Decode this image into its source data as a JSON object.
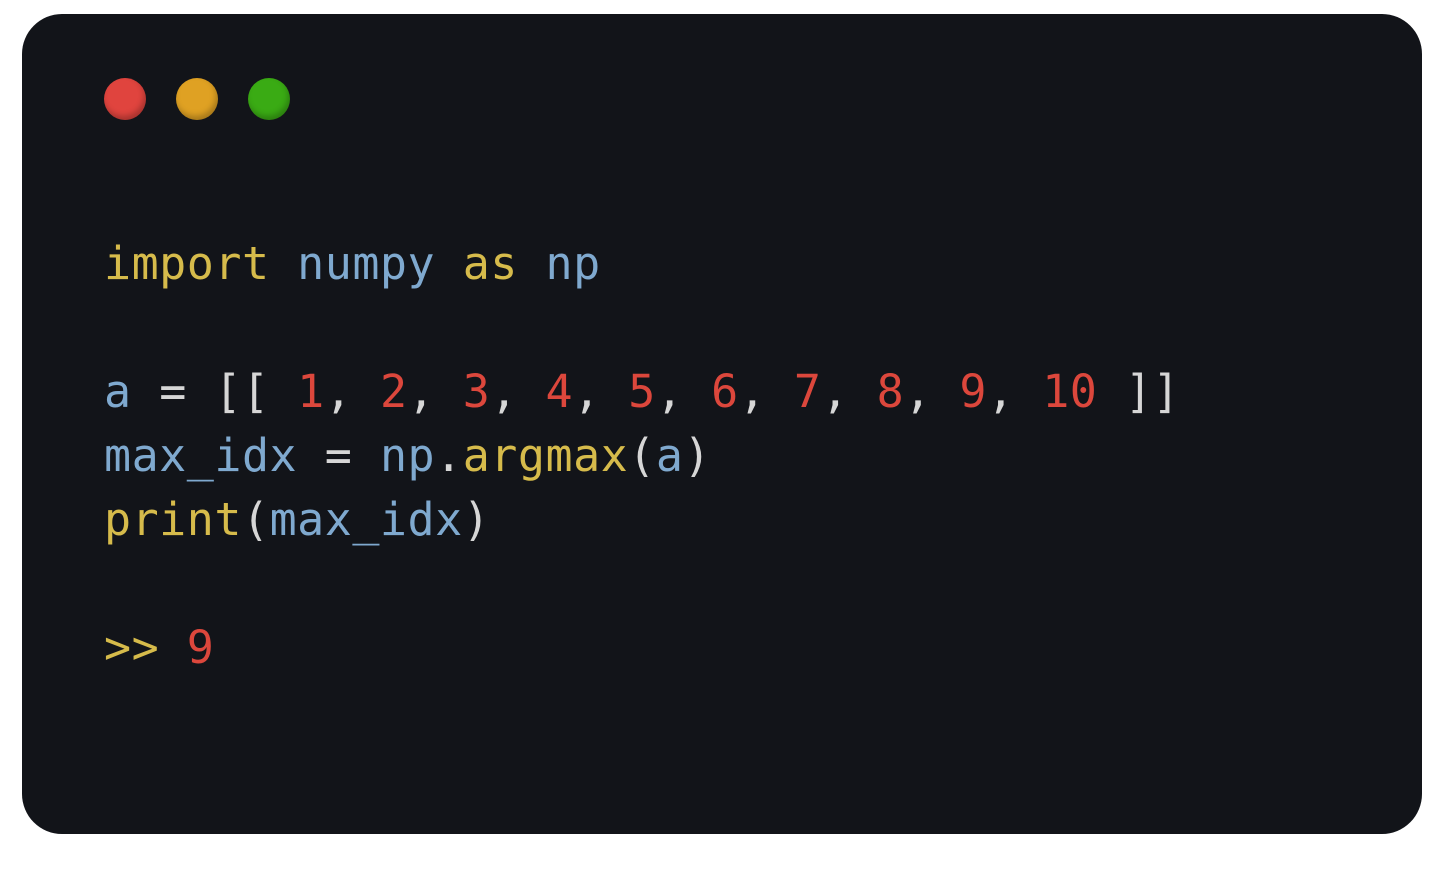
{
  "traffic_lights": {
    "red": "#e0443e",
    "yellow": "#dfa123",
    "green": "#3aab14"
  },
  "code": {
    "line1": {
      "import_kw": "import",
      "module": "numpy",
      "as_kw": "as",
      "alias": "np"
    },
    "line2_blank": "",
    "line3": {
      "var": "a",
      "eq": "=",
      "open": "[[ ",
      "nums": [
        "1",
        "2",
        "3",
        "4",
        "5",
        "6",
        "7",
        "8",
        "9",
        "10"
      ],
      "close": " ]]",
      "sep": ", "
    },
    "line4": {
      "var": "max_idx",
      "eq": "=",
      "obj": "np",
      "dot": ".",
      "fn": "argmax",
      "lp": "(",
      "arg": "a",
      "rp": ")"
    },
    "line5": {
      "fn": "print",
      "lp": "(",
      "arg": "max_idx",
      "rp": ")"
    },
    "line6_blank": "",
    "line7": {
      "prompt": ">>",
      "space": " ",
      "result": "9"
    }
  }
}
